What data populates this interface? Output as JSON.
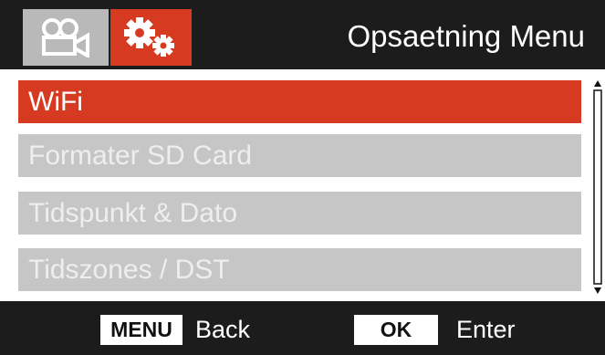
{
  "header": {
    "title": "Opsaetning Menu",
    "tabs": [
      {
        "icon": "video-camera-icon",
        "active": false
      },
      {
        "icon": "gears-icon",
        "active": true
      }
    ]
  },
  "menu": {
    "items": [
      {
        "label": "WiFi",
        "selected": true
      },
      {
        "label": "Formater SD Card",
        "selected": false
      },
      {
        "label": "Tidspunkt & Dato",
        "selected": false
      },
      {
        "label": "Tidszones / DST",
        "selected": false
      }
    ]
  },
  "footer": {
    "back_key": "MENU",
    "back_label": "Back",
    "enter_key": "OK",
    "enter_label": "Enter"
  },
  "colors": {
    "accent": "#d63a20",
    "item_background": "#c6c6c6",
    "bar_background": "#1c1c1c"
  }
}
